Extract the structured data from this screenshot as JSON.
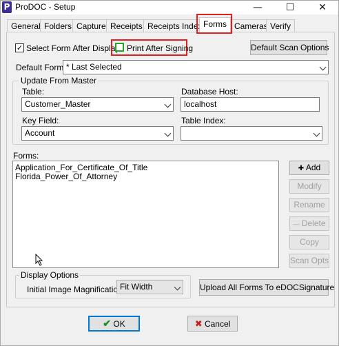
{
  "window": {
    "title": "ProDOC - Setup",
    "app_icon": "P",
    "minimize": "—",
    "maximize": "☐",
    "close": "✕"
  },
  "tabs": [
    {
      "label": "General"
    },
    {
      "label": "Folders"
    },
    {
      "label": "Capture"
    },
    {
      "label": "Receipts"
    },
    {
      "label": "Receipts Index"
    },
    {
      "label": "Forms",
      "active": true
    },
    {
      "label": "Cameras"
    },
    {
      "label": "Verify"
    }
  ],
  "options": {
    "select_form_after_display": {
      "label": "Select Form After Display",
      "checked": true,
      "mark": "✓"
    },
    "print_after_signing": {
      "label": "Print After Signing",
      "checked": false
    },
    "default_scan_options_label": "Default Scan Options"
  },
  "default_form": {
    "label": "Default Form:",
    "value": "* Last Selected"
  },
  "update_from_master": {
    "title": "Update From Master",
    "table_label": "Table:",
    "table_value": "Customer_Master",
    "db_host_label": "Database Host:",
    "db_host_value": "localhost",
    "key_field_label": "Key Field:",
    "key_field_value": "Account",
    "table_index_label": "Table Index:",
    "table_index_value": ""
  },
  "forms": {
    "label": "Forms:",
    "items": [
      "Application_For_Certificate_Of_Title",
      "Florida_Power_Of_Attorney"
    ],
    "buttons": {
      "add": "Add",
      "add_icon": "✚",
      "modify": "Modify",
      "rename": "Rename",
      "delete": "Delete",
      "delete_icon": "—",
      "copy": "Copy",
      "scan_opts": "Scan Opts"
    }
  },
  "display_options": {
    "title": "Display Options",
    "magnification_label": "Initial Image Magnification:",
    "magnification_value": "Fit Width"
  },
  "upload_button": "Upload All Forms To eDOCSignature",
  "footer": {
    "ok": "OK",
    "ok_icon": "✔",
    "cancel": "Cancel",
    "cancel_icon": "✖"
  },
  "colors": {
    "highlight": "#e02020",
    "ok_check": "#1a8f1a",
    "cancel_x": "#c81e1e",
    "print_checkbox_border": "#1faa1f"
  }
}
